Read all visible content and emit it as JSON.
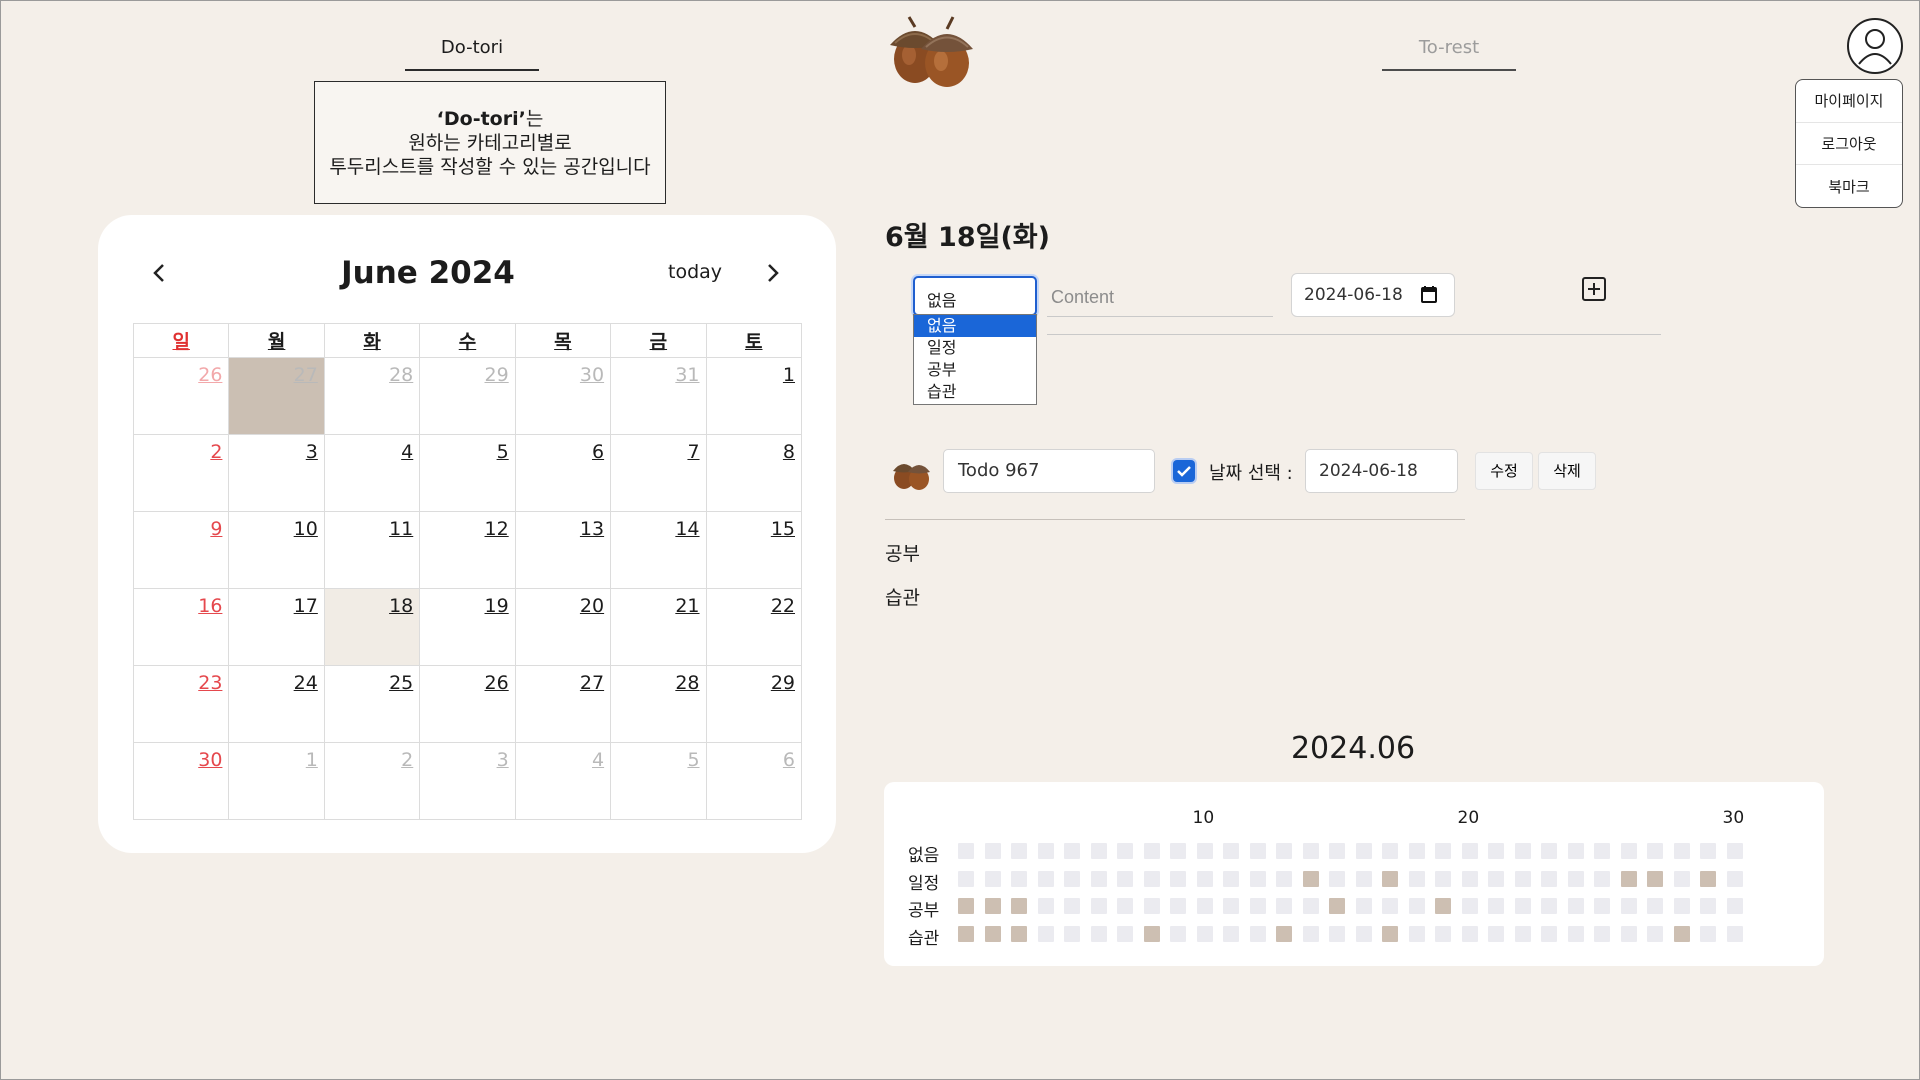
{
  "header": {
    "tab_left": "Do-tori",
    "tab_right": "To-rest",
    "profile_menu": [
      "마이페이지",
      "로그아웃",
      "북마크"
    ]
  },
  "description": {
    "brand": "‘Do-tori’",
    "brand_suffix": "는",
    "line2": "원하는 카테고리별로",
    "line3": "투두리스트를 작성할 수 있는 공간입니다"
  },
  "calendar": {
    "title": "June 2024",
    "prev_icon": "chevron-left-icon",
    "next_icon": "chevron-right-icon",
    "today_label": "today",
    "weekdays": [
      "일",
      "월",
      "화",
      "수",
      "목",
      "금",
      "토"
    ],
    "weeks": [
      [
        "26",
        "27",
        "28",
        "29",
        "30",
        "31",
        "1"
      ],
      [
        "2",
        "3",
        "4",
        "5",
        "6",
        "7",
        "8"
      ],
      [
        "9",
        "10",
        "11",
        "12",
        "13",
        "14",
        "15"
      ],
      [
        "16",
        "17",
        "18",
        "19",
        "20",
        "21",
        "22"
      ],
      [
        "23",
        "24",
        "25",
        "26",
        "27",
        "28",
        "29"
      ],
      [
        "30",
        "1",
        "2",
        "3",
        "4",
        "5",
        "6"
      ]
    ],
    "selected_date": "27",
    "today_date": "18",
    "colors": {
      "selected": "#cbbfb3",
      "today": "#f1ece5",
      "sunday": "#e5484d"
    }
  },
  "panel": {
    "date_heading": "6월 18일(화)",
    "form": {
      "category_selected": "없음",
      "category_options": [
        "없음",
        "일정",
        "공부",
        "습관"
      ],
      "content_placeholder": "Content",
      "date_value": "2024-06-18",
      "add_icon": "plus-square-icon"
    },
    "todo": {
      "title": "Todo 967",
      "checked": true,
      "date_label": "날짜 선택 :",
      "date_value": "2024-06-18",
      "edit_label": "수정",
      "delete_label": "삭제"
    },
    "groups": [
      "공부",
      "습관"
    ]
  },
  "heatmap": {
    "title": "2024.06",
    "column_labels": [
      {
        "day": 10,
        "label": "10"
      },
      {
        "day": 20,
        "label": "20"
      },
      {
        "day": 30,
        "label": "30"
      }
    ],
    "rows": [
      {
        "label": "없음",
        "active_days": []
      },
      {
        "label": "일정",
        "active_days": [
          14,
          17,
          26,
          27,
          29
        ]
      },
      {
        "label": "공부",
        "active_days": [
          1,
          2,
          3,
          15,
          19
        ]
      },
      {
        "label": "습관",
        "active_days": [
          1,
          2,
          3,
          8,
          13,
          17,
          28
        ]
      }
    ],
    "days": 30,
    "colors": {
      "empty": "#ebebf0",
      "active": "#cdbfb2"
    }
  }
}
